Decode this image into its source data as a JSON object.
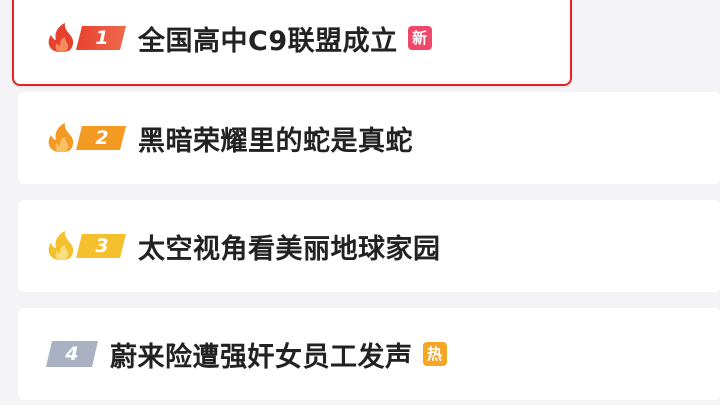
{
  "colors": {
    "selected_border": "#e42222",
    "rank1": "#e8402f",
    "rank2": "#f39a22",
    "rank3": "#f5c02e",
    "rank_other": "#a9b1c3",
    "badge_new": "#f0486a",
    "badge_hot": "#f5a623"
  },
  "items": [
    {
      "rank": "1",
      "title": "全国高中C9联盟成立",
      "badge": "新",
      "badge_type": "new",
      "icon": "flame-icon"
    },
    {
      "rank": "2",
      "title": "黑暗荣耀里的蛇是真蛇",
      "badge": "",
      "badge_type": "",
      "icon": "flame-icon"
    },
    {
      "rank": "3",
      "title": "太空视角看美丽地球家园",
      "badge": "",
      "badge_type": "",
      "icon": "flame-icon"
    },
    {
      "rank": "4",
      "title": "蔚来险遭强奸女员工发声",
      "badge": "热",
      "badge_type": "hot",
      "icon": ""
    }
  ]
}
